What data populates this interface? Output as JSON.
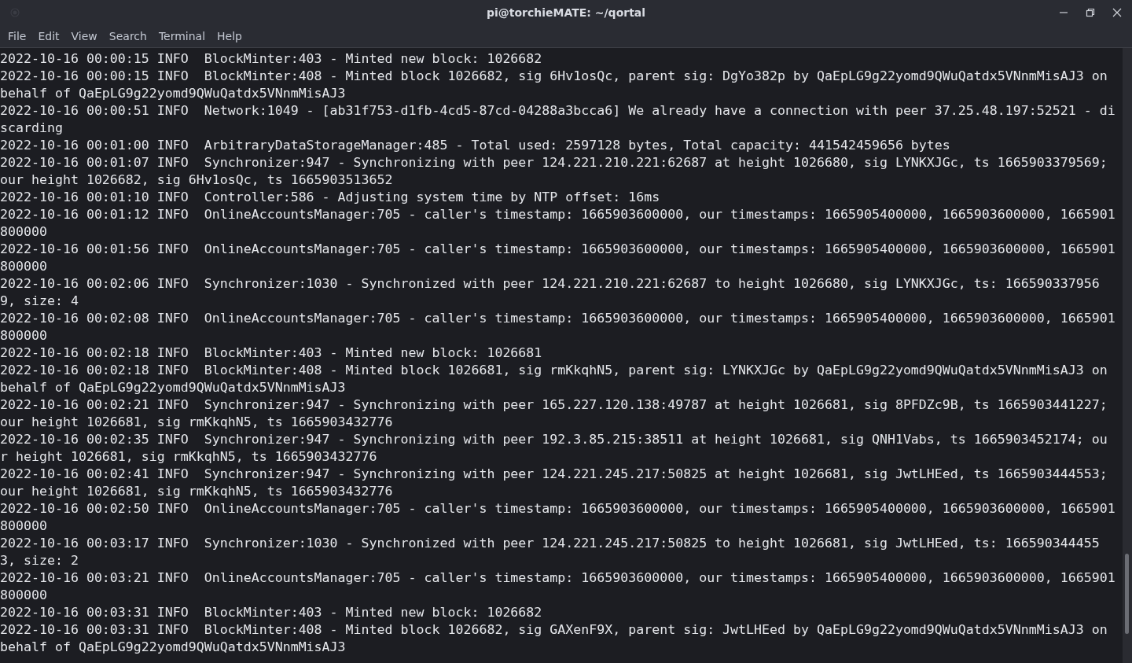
{
  "window": {
    "title": "pi@torchieMATE: ~/qortal"
  },
  "menu": [
    "File",
    "Edit",
    "View",
    "Search",
    "Terminal",
    "Help"
  ],
  "log_lines": [
    "2022-10-16 00:00:15 INFO  BlockMinter:403 - Minted new block: 1026682",
    "2022-10-16 00:00:15 INFO  BlockMinter:408 - Minted block 1026682, sig 6Hv1osQc, parent sig: DgYo382p by QaEpLG9g22yomd9QWuQatdx5VNnmMisAJ3 on behalf of QaEpLG9g22yomd9QWuQatdx5VNnmMisAJ3",
    "2022-10-16 00:00:51 INFO  Network:1049 - [ab31f753-d1fb-4cd5-87cd-04288a3bcca6] We already have a connection with peer 37.25.48.197:52521 - discarding",
    "2022-10-16 00:01:00 INFO  ArbitraryDataStorageManager:485 - Total used: 2597128 bytes, Total capacity: 441542459656 bytes",
    "2022-10-16 00:01:07 INFO  Synchronizer:947 - Synchronizing with peer 124.221.210.221:62687 at height 1026680, sig LYNKXJGc, ts 1665903379569; our height 1026682, sig 6Hv1osQc, ts 1665903513652",
    "2022-10-16 00:01:10 INFO  Controller:586 - Adjusting system time by NTP offset: 16ms",
    "2022-10-16 00:01:12 INFO  OnlineAccountsManager:705 - caller's timestamp: 1665903600000, our timestamps: 1665905400000, 1665903600000, 1665901800000",
    "2022-10-16 00:01:56 INFO  OnlineAccountsManager:705 - caller's timestamp: 1665903600000, our timestamps: 1665905400000, 1665903600000, 1665901800000",
    "2022-10-16 00:02:06 INFO  Synchronizer:1030 - Synchronized with peer 124.221.210.221:62687 to height 1026680, sig LYNKXJGc, ts: 1665903379569, size: 4",
    "2022-10-16 00:02:08 INFO  OnlineAccountsManager:705 - caller's timestamp: 1665903600000, our timestamps: 1665905400000, 1665903600000, 1665901800000",
    "2022-10-16 00:02:18 INFO  BlockMinter:403 - Minted new block: 1026681",
    "2022-10-16 00:02:18 INFO  BlockMinter:408 - Minted block 1026681, sig rmKkqhN5, parent sig: LYNKXJGc by QaEpLG9g22yomd9QWuQatdx5VNnmMisAJ3 on behalf of QaEpLG9g22yomd9QWuQatdx5VNnmMisAJ3",
    "2022-10-16 00:02:21 INFO  Synchronizer:947 - Synchronizing with peer 165.227.120.138:49787 at height 1026681, sig 8PFDZc9B, ts 1665903441227; our height 1026681, sig rmKkqhN5, ts 1665903432776",
    "2022-10-16 00:02:35 INFO  Synchronizer:947 - Synchronizing with peer 192.3.85.215:38511 at height 1026681, sig QNH1Vabs, ts 1665903452174; our height 1026681, sig rmKkqhN5, ts 1665903432776",
    "2022-10-16 00:02:41 INFO  Synchronizer:947 - Synchronizing with peer 124.221.245.217:50825 at height 1026681, sig JwtLHEed, ts 1665903444553; our height 1026681, sig rmKkqhN5, ts 1665903432776",
    "2022-10-16 00:02:50 INFO  OnlineAccountsManager:705 - caller's timestamp: 1665903600000, our timestamps: 1665905400000, 1665903600000, 1665901800000",
    "2022-10-16 00:03:17 INFO  Synchronizer:1030 - Synchronized with peer 124.221.245.217:50825 to height 1026681, sig JwtLHEed, ts: 1665903444553, size: 2",
    "2022-10-16 00:03:21 INFO  OnlineAccountsManager:705 - caller's timestamp: 1665903600000, our timestamps: 1665905400000, 1665903600000, 1665901800000",
    "2022-10-16 00:03:31 INFO  BlockMinter:403 - Minted new block: 1026682",
    "2022-10-16 00:03:31 INFO  BlockMinter:408 - Minted block 1026682, sig GAXenF9X, parent sig: JwtLHEed by QaEpLG9g22yomd9QWuQatdx5VNnmMisAJ3 on behalf of QaEpLG9g22yomd9QWuQatdx5VNnmMisAJ3"
  ]
}
